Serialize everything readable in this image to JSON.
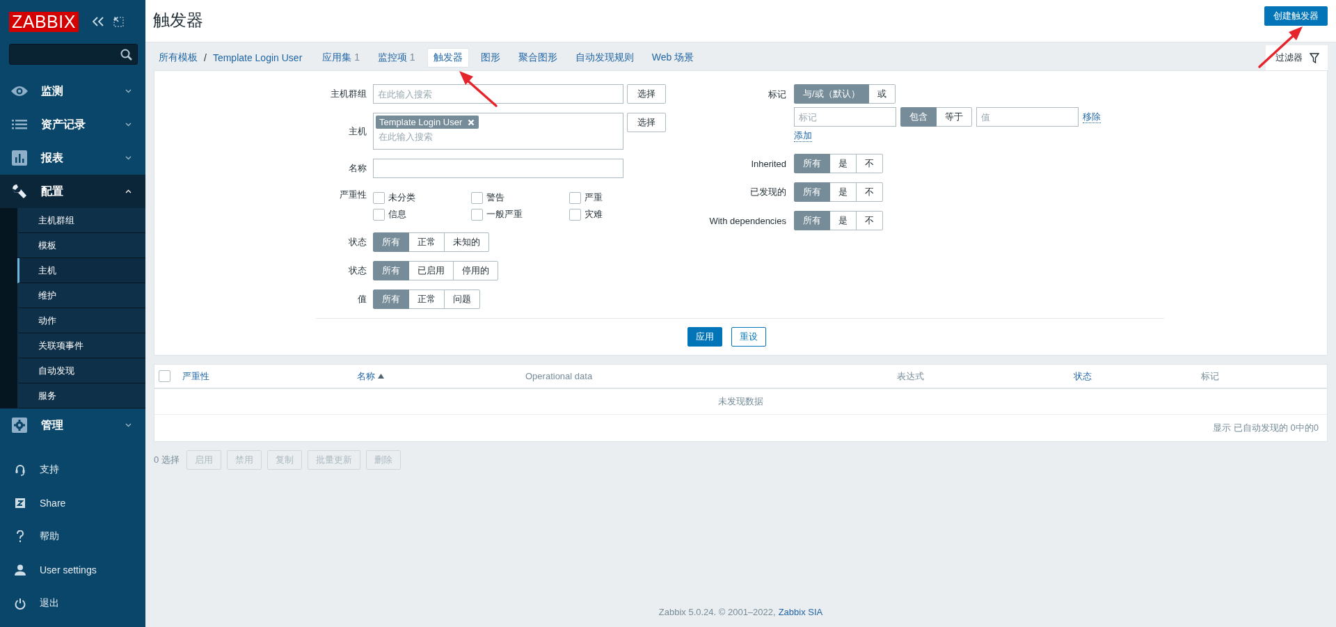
{
  "sidebar": {
    "logo": "ZABBIX",
    "menu": [
      {
        "label": "监测",
        "expanded": false
      },
      {
        "label": "资产记录",
        "expanded": false
      },
      {
        "label": "报表",
        "expanded": false
      },
      {
        "label": "配置",
        "expanded": true,
        "children": [
          {
            "label": "主机群组",
            "selected": false
          },
          {
            "label": "模板",
            "selected": false
          },
          {
            "label": "主机",
            "selected": true
          },
          {
            "label": "维护",
            "selected": false
          },
          {
            "label": "动作",
            "selected": false
          },
          {
            "label": "关联项事件",
            "selected": false
          },
          {
            "label": "自动发现",
            "selected": false
          },
          {
            "label": "服务",
            "selected": false
          }
        ]
      },
      {
        "label": "管理",
        "expanded": false
      }
    ],
    "bottom_items": [
      "支持",
      "Share",
      "帮助",
      "User settings",
      "退出"
    ]
  },
  "header": {
    "title": "触发器",
    "create_button": "创建触发器"
  },
  "breadcrumbs": [
    "所有模板",
    "Template Login User"
  ],
  "breadcrumb_separator": "/",
  "tabs": [
    {
      "label": "应用集",
      "count": "1",
      "selected": false
    },
    {
      "label": "监控项",
      "count": "1",
      "selected": false
    },
    {
      "label": "触发器",
      "selected": true
    },
    {
      "label": "图形",
      "selected": false
    },
    {
      "label": "聚合图形",
      "selected": false
    },
    {
      "label": "自动发现规则",
      "selected": false
    },
    {
      "label": "Web 场景",
      "selected": false
    }
  ],
  "filter": {
    "tab": "过滤器",
    "host_groups": {
      "label": "主机群组",
      "placeholder": "在此输入搜索",
      "button": "选择"
    },
    "hosts": {
      "label": "主机",
      "chips": [
        "Template Login User"
      ],
      "placeholder": "在此输入搜索",
      "button": "选择"
    },
    "name": {
      "label": "名称"
    },
    "severity": {
      "label": "严重性",
      "options": [
        {
          "label": "未分类",
          "checked": false
        },
        {
          "label": "警告",
          "checked": false
        },
        {
          "label": "严重",
          "checked": false
        },
        {
          "label": "信息",
          "checked": false
        },
        {
          "label": "一般严重",
          "checked": false
        },
        {
          "label": "灾难",
          "checked": false
        }
      ]
    },
    "segments_left": [
      {
        "label": "状态",
        "options": [
          {
            "label": "所有",
            "selected": true
          },
          {
            "label": "正常",
            "selected": false
          },
          {
            "label": "未知的",
            "selected": false
          }
        ]
      },
      {
        "label": "状态",
        "options": [
          {
            "label": "所有",
            "selected": true
          },
          {
            "label": "已启用",
            "selected": false
          },
          {
            "label": "停用的",
            "selected": false
          }
        ]
      },
      {
        "label": "值",
        "options": [
          {
            "label": "所有",
            "selected": true
          },
          {
            "label": "正常",
            "selected": false
          },
          {
            "label": "问题",
            "selected": false
          }
        ]
      }
    ],
    "tags": {
      "label": "标记",
      "options": [
        {
          "label": "与/或（默认）",
          "selected": true
        },
        {
          "label": "或",
          "selected": false
        }
      ],
      "tag_placeholder": "标记",
      "operators": [
        {
          "label": "包含",
          "selected": true
        },
        {
          "label": "等于",
          "selected": false
        }
      ],
      "value_placeholder": "值",
      "remove": "移除",
      "add": "添加"
    },
    "segments_right": [
      {
        "label": "Inherited",
        "options": [
          {
            "label": "所有",
            "selected": true
          },
          {
            "label": "是",
            "selected": false
          },
          {
            "label": "不",
            "selected": false
          }
        ]
      },
      {
        "label": "已发现的",
        "options": [
          {
            "label": "所有",
            "selected": true
          },
          {
            "label": "是",
            "selected": false
          },
          {
            "label": "不",
            "selected": false
          }
        ]
      },
      {
        "label": "With dependencies",
        "options": [
          {
            "label": "所有",
            "selected": true
          },
          {
            "label": "是",
            "selected": false
          },
          {
            "label": "不",
            "selected": false
          }
        ]
      }
    ],
    "apply": "应用",
    "reset": "重设"
  },
  "table": {
    "select_all": false,
    "columns": [
      {
        "label": "严重性",
        "sortable": true,
        "sorted": false
      },
      {
        "label": "名称",
        "sortable": true,
        "sorted": true
      },
      {
        "label": "Operational data",
        "sortable": false,
        "sorted": false
      },
      {
        "label": "表达式",
        "sortable": false,
        "sorted": false
      },
      {
        "label": "状态",
        "sortable": true,
        "sorted": false
      },
      {
        "label": "标记",
        "sortable": false,
        "sorted": false
      }
    ],
    "empty": "未发现数据",
    "summary": "显示 已自动发现的 0中的0"
  },
  "actions": {
    "selected_count": "0 选择",
    "buttons": [
      {
        "label": "启用",
        "disabled": true
      },
      {
        "label": "禁用",
        "disabled": true
      },
      {
        "label": "复制",
        "disabled": true
      },
      {
        "label": "批量更新",
        "disabled": true
      },
      {
        "label": "删除",
        "disabled": true
      }
    ]
  },
  "footer": {
    "text": "Zabbix 5.0.24. © 2001–2022,",
    "link": "Zabbix SIA"
  }
}
